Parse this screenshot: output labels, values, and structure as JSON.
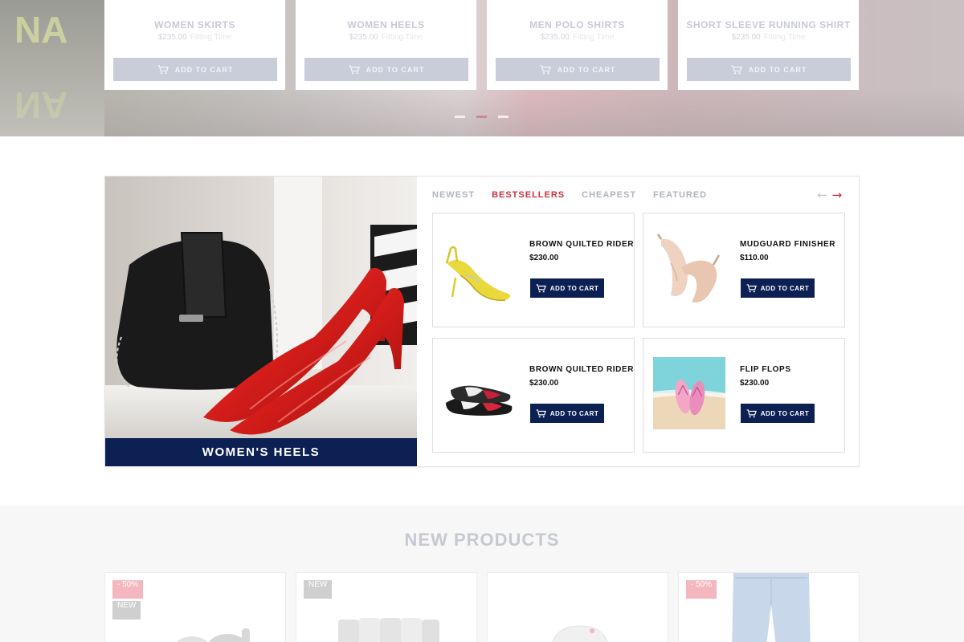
{
  "hero": {
    "products": [
      {
        "name": "WOMEN SKIRTS",
        "price": "$235.00",
        "old_price": "Fitting Time",
        "cta": "ADD TO CART"
      },
      {
        "name": "WOMEN HEELS",
        "price": "$235.00",
        "old_price": "Fitting Time",
        "cta": "ADD TO CART"
      },
      {
        "name": "MEN POLO SHIRTS",
        "price": "$235.00",
        "old_price": "Fitting Time",
        "cta": "ADD TO CART"
      },
      {
        "name": "SHORT SLEEVE RUNNING SHIRT",
        "price": "$235.00",
        "old_price": "Fitting Time",
        "cta": "ADD TO CART"
      }
    ],
    "background_text": "NA",
    "active_dot": 1
  },
  "bestsellers": {
    "banner_caption": "WOMEN'S HEELS",
    "tabs": [
      "NEWEST",
      "BESTSELLERS",
      "CHEAPEST",
      "FEATURED"
    ],
    "active_tab": 1,
    "arrows": {
      "prev": "←",
      "next": "→"
    },
    "products": [
      {
        "name": "BROWN QUILTED RIDER",
        "price": "$230.00",
        "cta": "ADD TO CART",
        "icon": "yellow-heel-icon"
      },
      {
        "name": "MUDGUARD FINISHER",
        "price": "$110.00",
        "cta": "ADD TO CART",
        "icon": "nude-heels-icon"
      },
      {
        "name": "BROWN QUILTED RIDER",
        "price": "$230.00",
        "cta": "ADD TO CART",
        "icon": "ballet-flats-icon"
      },
      {
        "name": "FLIP FLOPS",
        "price": "$230.00",
        "cta": "ADD TO CART",
        "icon": "flip-flops-icon"
      }
    ]
  },
  "new_products": {
    "title": "NEW PRODUCTS",
    "cards": [
      {
        "badges": [
          "- 50%",
          "NEW"
        ]
      },
      {
        "badges": [
          "NEW"
        ]
      },
      {
        "badges": []
      },
      {
        "badges": [
          "- 50%"
        ]
      }
    ]
  },
  "colors": {
    "navy": "#0d2053",
    "accent_red": "#c8323f",
    "muted_button": "#c9ccd9"
  }
}
